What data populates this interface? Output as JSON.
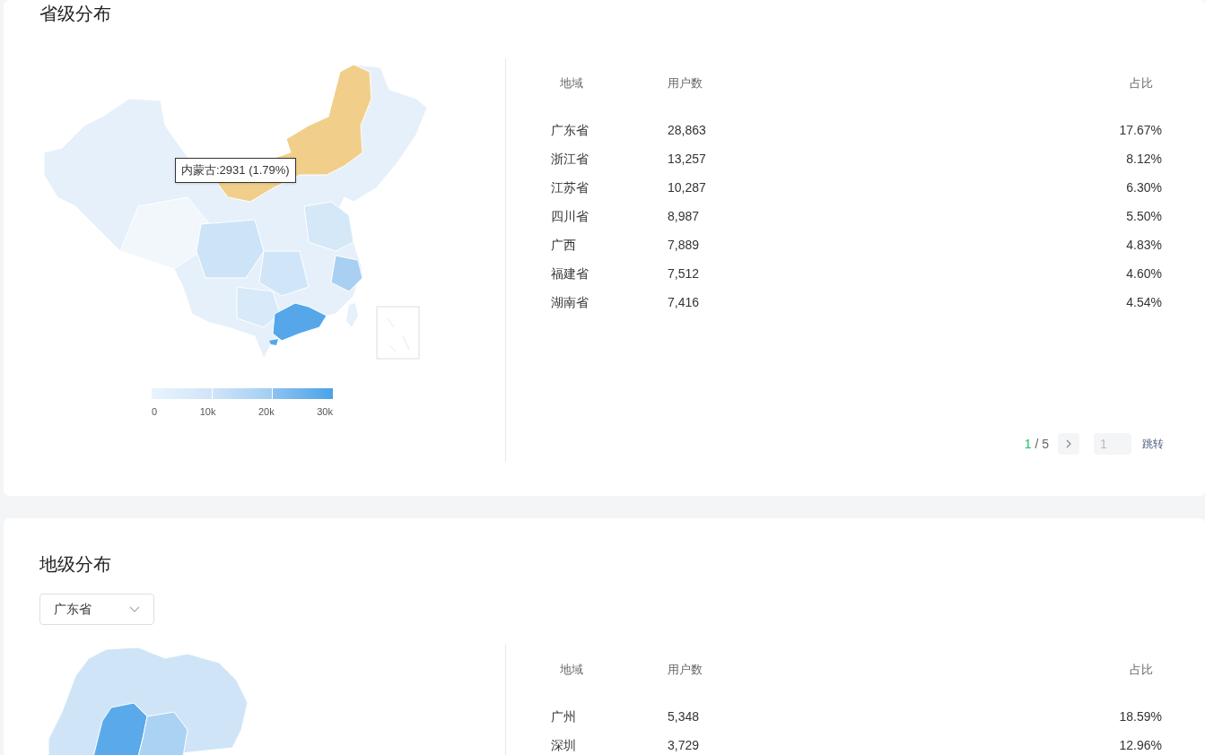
{
  "sections": [
    {
      "title": "省级分布",
      "map": {
        "kind": "china",
        "tooltip": "内蒙古:2931 (1.79%)",
        "legend": [
          "0",
          "10k",
          "20k",
          "30k"
        ]
      },
      "table": {
        "columns": [
          "地域",
          "用户数",
          "占比"
        ],
        "rows": [
          {
            "region": "广东省",
            "users": "28,863",
            "share": "17.67%"
          },
          {
            "region": "浙江省",
            "users": "13,257",
            "share": "8.12%"
          },
          {
            "region": "江苏省",
            "users": "10,287",
            "share": "6.30%"
          },
          {
            "region": "四川省",
            "users": "8,987",
            "share": "5.50%"
          },
          {
            "region": "广西",
            "users": "7,889",
            "share": "4.83%"
          },
          {
            "region": "福建省",
            "users": "7,512",
            "share": "4.60%"
          },
          {
            "region": "湖南省",
            "users": "7,416",
            "share": "4.54%"
          }
        ],
        "pagination": {
          "current": "1",
          "total": "/ 5",
          "jump_value": "1",
          "jump_label": "跳转"
        }
      }
    },
    {
      "title": "地级分布",
      "select": {
        "value": "广东省"
      },
      "map": {
        "kind": "province"
      },
      "table": {
        "columns": [
          "地域",
          "用户数",
          "占比"
        ],
        "rows": [
          {
            "region": "广州",
            "users": "5,348",
            "share": "18.59%"
          },
          {
            "region": "深圳",
            "users": "3,729",
            "share": "12.96%"
          }
        ]
      }
    }
  ]
}
